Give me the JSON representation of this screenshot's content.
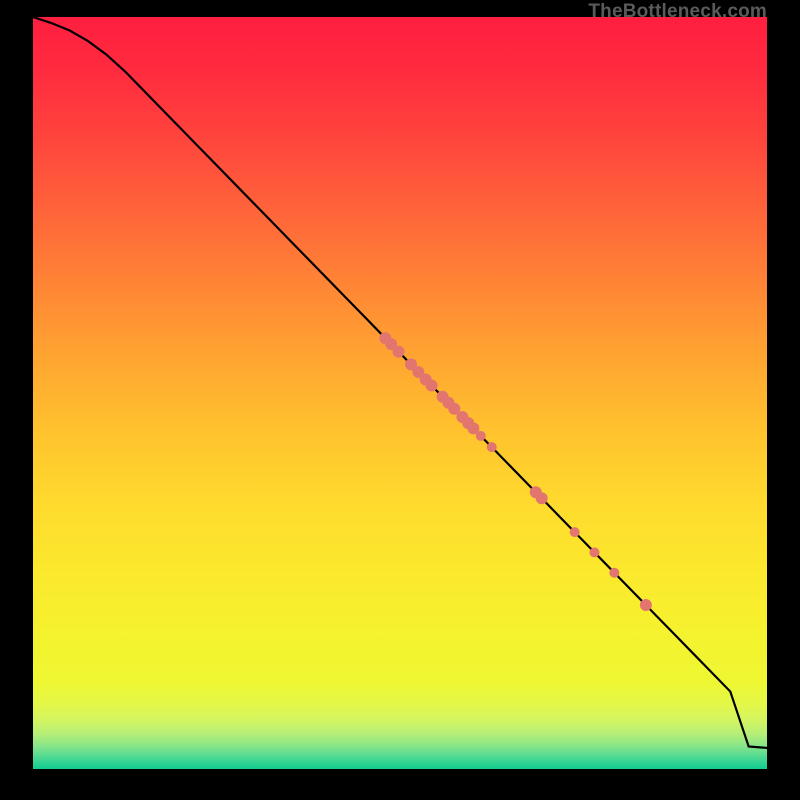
{
  "watermark": "TheBottleneck.com",
  "colors": {
    "marker": "#e2766f",
    "curve": "#000000"
  },
  "chart_data": {
    "type": "line",
    "title": "",
    "xlabel": "",
    "ylabel": "",
    "xlim": [
      0,
      100
    ],
    "ylim": [
      0,
      100
    ],
    "series": [
      {
        "name": "curve",
        "x": [
          0,
          2.5,
          5,
          7.5,
          10,
          12.5,
          15,
          17.5,
          20,
          22.5,
          25,
          27.5,
          30,
          32.5,
          35,
          37.5,
          40,
          42.5,
          45,
          47.5,
          50,
          52.5,
          55,
          57.5,
          60,
          62.5,
          65,
          67.5,
          70,
          72.5,
          75,
          77.5,
          80,
          82.5,
          85,
          87.5,
          90,
          92.5,
          95,
          97.5,
          100
        ],
        "y": [
          100,
          99.2,
          98.2,
          96.8,
          95.0,
          92.8,
          90.3,
          87.8,
          85.3,
          82.8,
          80.3,
          77.8,
          75.3,
          72.8,
          70.3,
          67.8,
          65.3,
          62.8,
          60.3,
          57.8,
          55.3,
          52.8,
          50.3,
          47.8,
          45.3,
          42.8,
          40.3,
          37.8,
          35.3,
          32.8,
          30.3,
          27.8,
          25.3,
          22.8,
          20.3,
          17.8,
          15.3,
          12.8,
          10.3,
          3.0,
          2.8
        ]
      }
    ],
    "markers": [
      {
        "x": 48.0,
        "y": 57.3,
        "r": 6
      },
      {
        "x": 48.8,
        "y": 56.5,
        "r": 6
      },
      {
        "x": 49.8,
        "y": 55.5,
        "r": 6
      },
      {
        "x": 51.5,
        "y": 53.8,
        "r": 6
      },
      {
        "x": 52.5,
        "y": 52.8,
        "r": 6
      },
      {
        "x": 53.5,
        "y": 51.8,
        "r": 6
      },
      {
        "x": 54.3,
        "y": 51.0,
        "r": 6
      },
      {
        "x": 55.8,
        "y": 49.5,
        "r": 6
      },
      {
        "x": 56.6,
        "y": 48.7,
        "r": 6
      },
      {
        "x": 57.4,
        "y": 47.9,
        "r": 6
      },
      {
        "x": 58.5,
        "y": 46.8,
        "r": 6
      },
      {
        "x": 59.3,
        "y": 46.0,
        "r": 6
      },
      {
        "x": 60.0,
        "y": 45.3,
        "r": 6
      },
      {
        "x": 61.0,
        "y": 44.3,
        "r": 5
      },
      {
        "x": 62.5,
        "y": 42.8,
        "r": 5
      },
      {
        "x": 68.5,
        "y": 36.8,
        "r": 6
      },
      {
        "x": 69.3,
        "y": 36.0,
        "r": 6
      },
      {
        "x": 73.8,
        "y": 31.5,
        "r": 5
      },
      {
        "x": 76.5,
        "y": 28.8,
        "r": 5
      },
      {
        "x": 79.2,
        "y": 26.1,
        "r": 5
      },
      {
        "x": 83.5,
        "y": 21.8,
        "r": 6
      }
    ],
    "gradient_stops": [
      {
        "offset": 0.0,
        "color": "#ff1f3f"
      },
      {
        "offset": 0.07,
        "color": "#ff2b3f"
      },
      {
        "offset": 0.15,
        "color": "#ff413d"
      },
      {
        "offset": 0.25,
        "color": "#ff613a"
      },
      {
        "offset": 0.35,
        "color": "#ff8335"
      },
      {
        "offset": 0.45,
        "color": "#ffa431"
      },
      {
        "offset": 0.55,
        "color": "#ffc22e"
      },
      {
        "offset": 0.65,
        "color": "#ffdb2d"
      },
      {
        "offset": 0.74,
        "color": "#fbe92d"
      },
      {
        "offset": 0.82,
        "color": "#f5f22f"
      },
      {
        "offset": 0.885,
        "color": "#eef732"
      },
      {
        "offset": 0.915,
        "color": "#e3f74a"
      },
      {
        "offset": 0.935,
        "color": "#d3f560"
      },
      {
        "offset": 0.952,
        "color": "#b8ef76"
      },
      {
        "offset": 0.965,
        "color": "#95e884"
      },
      {
        "offset": 0.976,
        "color": "#6fe08e"
      },
      {
        "offset": 0.986,
        "color": "#46d892"
      },
      {
        "offset": 0.994,
        "color": "#26d191"
      },
      {
        "offset": 1.0,
        "color": "#12cd8e"
      }
    ]
  }
}
